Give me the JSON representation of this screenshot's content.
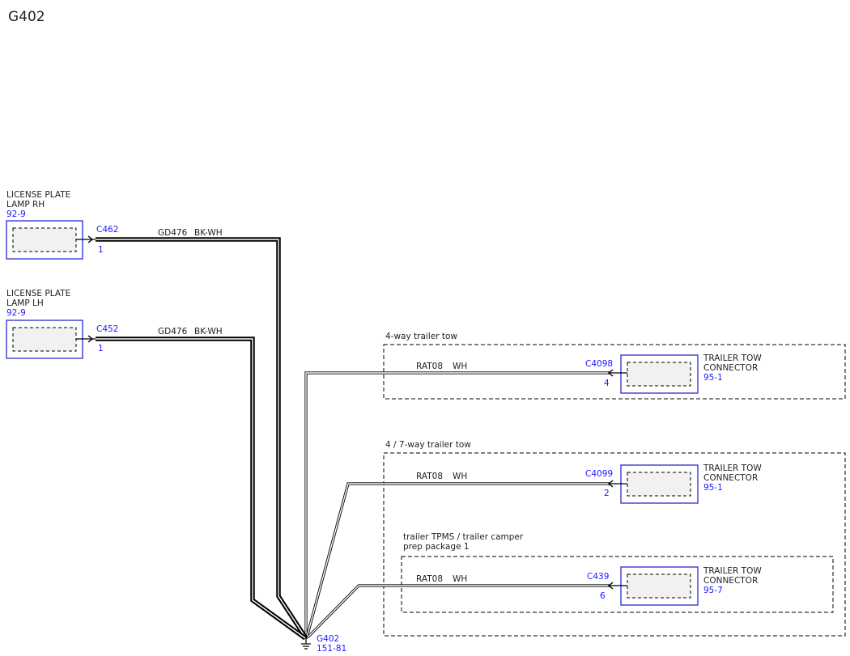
{
  "page_title": "G402",
  "colors": {
    "component_border": "#2a2ad4",
    "ref_text": "#1a1aff",
    "wire": "#000000",
    "fill": "#f1f1f1"
  },
  "components": {
    "lamp_rh": {
      "line1": "LICENSE PLATE",
      "line2": "LAMP RH",
      "ref": "92-9",
      "connector": "C462",
      "pin": "1"
    },
    "lamp_lh": {
      "line1": "LICENSE PLATE",
      "line2": "LAMP LH",
      "ref": "92-9",
      "connector": "C452",
      "pin": "1"
    },
    "tow_4way": {
      "line1": "TRAILER TOW",
      "line2": "CONNECTOR",
      "ref": "95-1",
      "connector": "C4098",
      "pin": "4"
    },
    "tow_7way": {
      "line1": "TRAILER TOW",
      "line2": "CONNECTOR",
      "ref": "95-1",
      "connector": "C4099",
      "pin": "2"
    },
    "tow_tpms": {
      "line1": "TRAILER TOW",
      "line2": "CONNECTOR",
      "ref": "95-7",
      "connector": "C439",
      "pin": "6"
    }
  },
  "options": {
    "four_way": "4-way trailer tow",
    "seven_way": "4 / 7-way trailer tow",
    "tpms_line1": "trailer TPMS / trailer camper",
    "tpms_line2": "prep package 1"
  },
  "wires": {
    "w1_circuit": "GD476",
    "w1_color": "BK-WH",
    "w2_circuit": "GD476",
    "w2_color": "BK-WH",
    "w3_circuit": "RAT08",
    "w3_color": "WH",
    "w4_circuit": "RAT08",
    "w4_color": "WH",
    "w5_circuit": "RAT08",
    "w5_color": "WH"
  },
  "ground": {
    "id": "G402",
    "ref": "151-81"
  }
}
